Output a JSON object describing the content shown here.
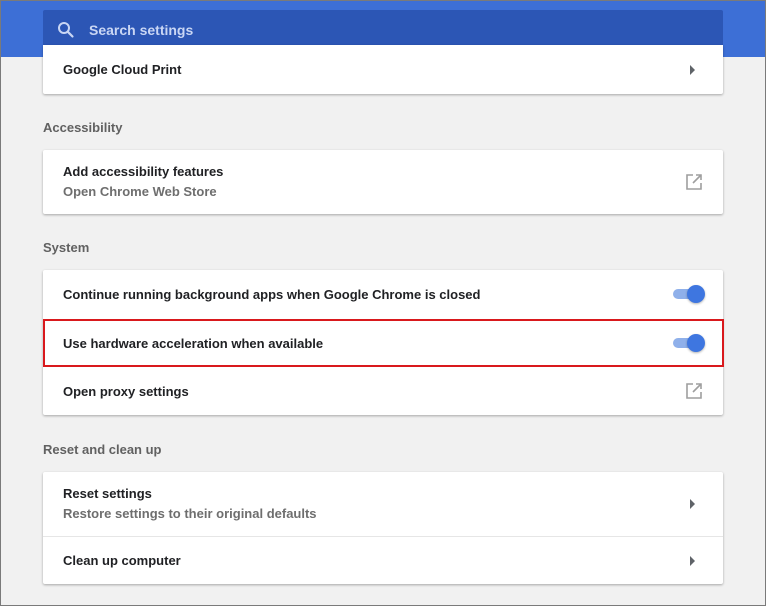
{
  "search": {
    "placeholder": "Search settings"
  },
  "printing": {
    "cloud_print_label": "Google Cloud Print"
  },
  "accessibility": {
    "section_title": "Accessibility",
    "add_features_label": "Add accessibility features",
    "add_features_sub": "Open Chrome Web Store"
  },
  "system": {
    "section_title": "System",
    "background_apps_label": "Continue running background apps when Google Chrome is closed",
    "background_apps_enabled": true,
    "hardware_accel_label": "Use hardware acceleration when available",
    "hardware_accel_enabled": true,
    "proxy_label": "Open proxy settings"
  },
  "reset": {
    "section_title": "Reset and clean up",
    "reset_label": "Reset settings",
    "reset_sub": "Restore settings to their original defaults",
    "cleanup_label": "Clean up computer"
  },
  "colors": {
    "header": "#3d6fd6",
    "search_bg": "#2c56b5",
    "toggle_on": "#3e76e0",
    "highlight": "#d9191d"
  }
}
